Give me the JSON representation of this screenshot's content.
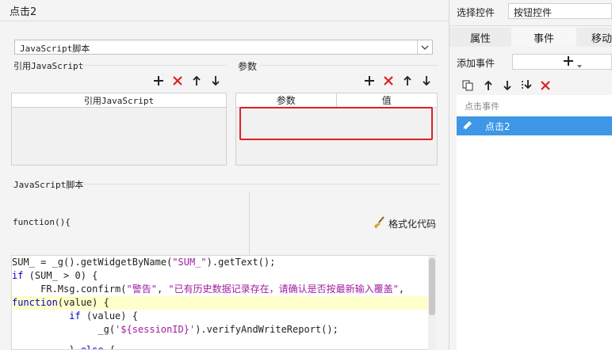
{
  "left_panel": {
    "title": "点击2",
    "script_type": "JavaScript脚本",
    "ref_js_label": "引用JavaScript",
    "params_label": "参数",
    "ref_table_header": "引用JavaScript",
    "params_table_headers": [
      "参数",
      "值"
    ],
    "script_section_label": "JavaScript脚本",
    "function_header": "function(){",
    "format_code_label": "格式化代码",
    "code_lines": [
      "SUM_ = _g().getWidgetByName(\"SUM_\").getText();",
      "if (SUM_ > 0) {",
      "     FR.Msg.confirm(\"警告\", \"已有历史数据记录存在，请确认是否按最新输入覆盖\",",
      "function(value) {",
      "          if (value) {",
      "               _g('${sessionID}').verifyAndWriteReport();",
      "",
      "          } else {"
    ]
  },
  "right_panel": {
    "select_control_label": "选择控件",
    "control_value": "按钮控件",
    "tabs": [
      "属性",
      "事件",
      "移动"
    ],
    "add_event_label": "添加事件",
    "event_list_header": "点击事件",
    "event_item": "点击2"
  },
  "colors": {
    "accent_blue": "#3d96e6",
    "highlight_red": "#e02020",
    "keyword_blue": "#0000cc",
    "string_magenta": "#a01ca0",
    "line_highlight": "#ffffcc"
  },
  "icons": [
    "plus-icon",
    "delete-x-icon",
    "arrow-up-icon",
    "arrow-down-icon",
    "copy-icon",
    "move-bottom-icon",
    "pencil-icon",
    "broom-icon",
    "chevron-down-icon"
  ]
}
